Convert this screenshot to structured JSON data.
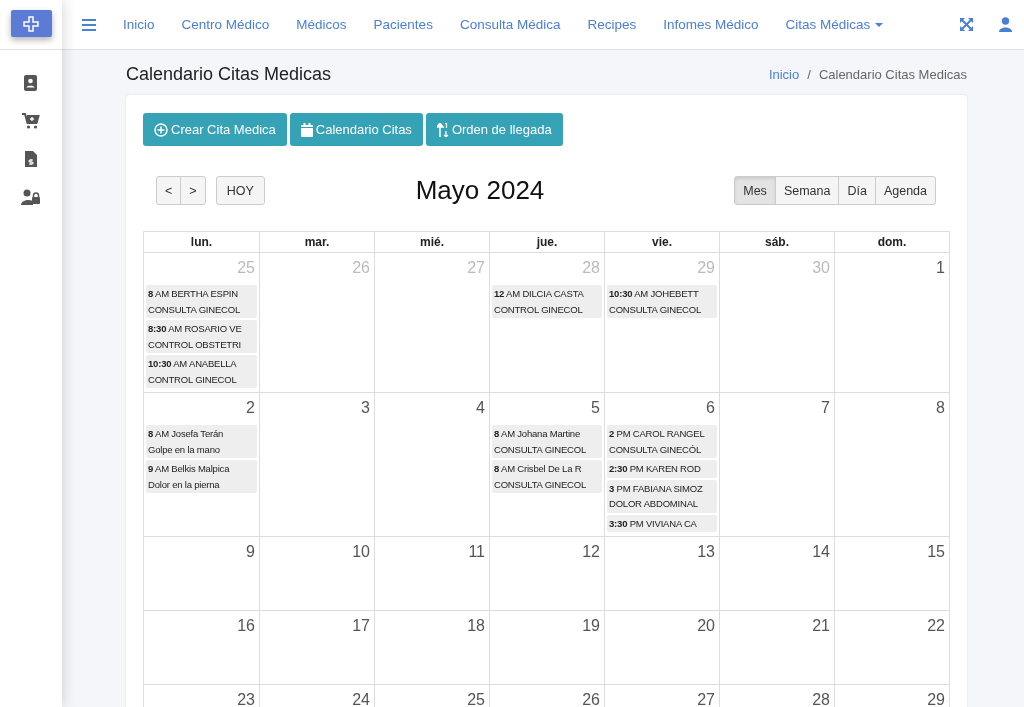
{
  "navbar": {
    "links": [
      {
        "label": "Inicio",
        "dropdown": false
      },
      {
        "label": "Centro Médico",
        "dropdown": false
      },
      {
        "label": "Médicos",
        "dropdown": false
      },
      {
        "label": "Pacientes",
        "dropdown": false
      },
      {
        "label": "Consulta Médica",
        "dropdown": false
      },
      {
        "label": "Recipes",
        "dropdown": false
      },
      {
        "label": "Infomes Médico",
        "dropdown": false
      },
      {
        "label": "Citas Médicas",
        "dropdown": true
      }
    ]
  },
  "page": {
    "title": "Calendario Citas Medicas",
    "breadcrumb": [
      {
        "label": "Inicio",
        "link": true
      },
      {
        "separator": "/",
        "label": "Calendario Citas Medicas",
        "link": false
      }
    ]
  },
  "actions": [
    {
      "label": "Crear Cita Medica",
      "kind": "create"
    },
    {
      "label": "Calendario Citas",
      "kind": "calendar"
    },
    {
      "label": "Orden de llegada",
      "kind": "order"
    }
  ],
  "calendar": {
    "nav": [
      "<",
      ">"
    ],
    "today": "HOY",
    "title": "Mayo 2024",
    "views": [
      {
        "label": "Mes",
        "selected": true
      },
      {
        "label": "Semana",
        "selected": false
      },
      {
        "label": "Día",
        "selected": false
      },
      {
        "label": "Agenda",
        "selected": false
      }
    ],
    "weekdays": [
      "lun.",
      "mar.",
      "mié.",
      "jue.",
      "vie.",
      "sáb.",
      "dom."
    ],
    "weeks": [
      [
        {
          "day": "25",
          "muted": true,
          "events": [
            {
              "text": "**8** AM BERTHA ESPIN",
              "detail": "CONSULTA GINECOL"
            },
            {
              "text": "**8:30** AM ROSARIO VE",
              "detail": "CONTROL OBSTETRI"
            },
            {
              "text": "**10:30** AM ANABELLA",
              "detail": "CONTROL GINECOL"
            }
          ]
        },
        {
          "day": "26",
          "muted": true
        },
        {
          "day": "27",
          "muted": true
        },
        {
          "day": "28",
          "muted": true,
          "events": [
            {
              "text": "**12** AM DILCIA CASTA",
              "detail": "CONTROL GINECOL"
            }
          ]
        },
        {
          "day": "29",
          "muted": true,
          "events": [
            {
              "text": "**10:30** AM JOHEBETT",
              "detail": "CONSULTA GINECOL"
            }
          ]
        },
        {
          "day": "30",
          "muted": true
        },
        {
          "day": "1",
          "muted": false
        }
      ],
      [
        {
          "day": "2",
          "muted": false,
          "events": [
            {
              "text": "**8** AM Josefa Terán",
              "detail": "Golpe en la mano"
            },
            {
              "text": "**9** AM Belkis Malpica",
              "detail": "Dolor en la pierna"
            }
          ]
        },
        {
          "day": "3",
          "muted": false
        },
        {
          "day": "4",
          "muted": false
        },
        {
          "day": "5",
          "muted": false,
          "events": [
            {
              "text": "**8** AM Johana Martine",
              "detail": "CONSULTA GINECOL"
            },
            {
              "text": "**8** AM Crisbel De La R",
              "detail": "CONSULTA GINECOL"
            }
          ]
        },
        {
          "day": "6",
          "muted": false,
          "events": [
            {
              "text": "**2** PM CAROL RANGEL",
              "detail": "CONSULTA GINECÓL"
            },
            {
              "text": "**2:30** PM KAREN ROD"
            },
            {
              "text": "**3** PM FABIANA SIMOZ",
              "detail": "DOLOR ABDOMINAL"
            },
            {
              "text": "**3:30** PM VIVIANA CA"
            }
          ]
        },
        {
          "day": "7",
          "muted": false
        },
        {
          "day": "8",
          "muted": false
        }
      ],
      [
        {
          "day": "9",
          "muted": false
        },
        {
          "day": "10",
          "muted": false
        },
        {
          "day": "11",
          "muted": false
        },
        {
          "day": "12",
          "muted": false
        },
        {
          "day": "13",
          "muted": false
        },
        {
          "day": "14",
          "muted": false
        },
        {
          "day": "15",
          "muted": false
        }
      ],
      [
        {
          "day": "16",
          "muted": false
        },
        {
          "day": "17",
          "muted": false
        },
        {
          "day": "18",
          "muted": false
        },
        {
          "day": "19",
          "muted": false
        },
        {
          "day": "20",
          "muted": false
        },
        {
          "day": "21",
          "muted": false
        },
        {
          "day": "22",
          "muted": false
        }
      ],
      [
        {
          "day": "23",
          "muted": false
        },
        {
          "day": "24",
          "muted": false
        },
        {
          "day": "25",
          "muted": false
        },
        {
          "day": "26",
          "muted": false
        },
        {
          "day": "27",
          "muted": false
        },
        {
          "day": "28",
          "muted": false
        },
        {
          "day": "29",
          "muted": false
        }
      ]
    ]
  }
}
